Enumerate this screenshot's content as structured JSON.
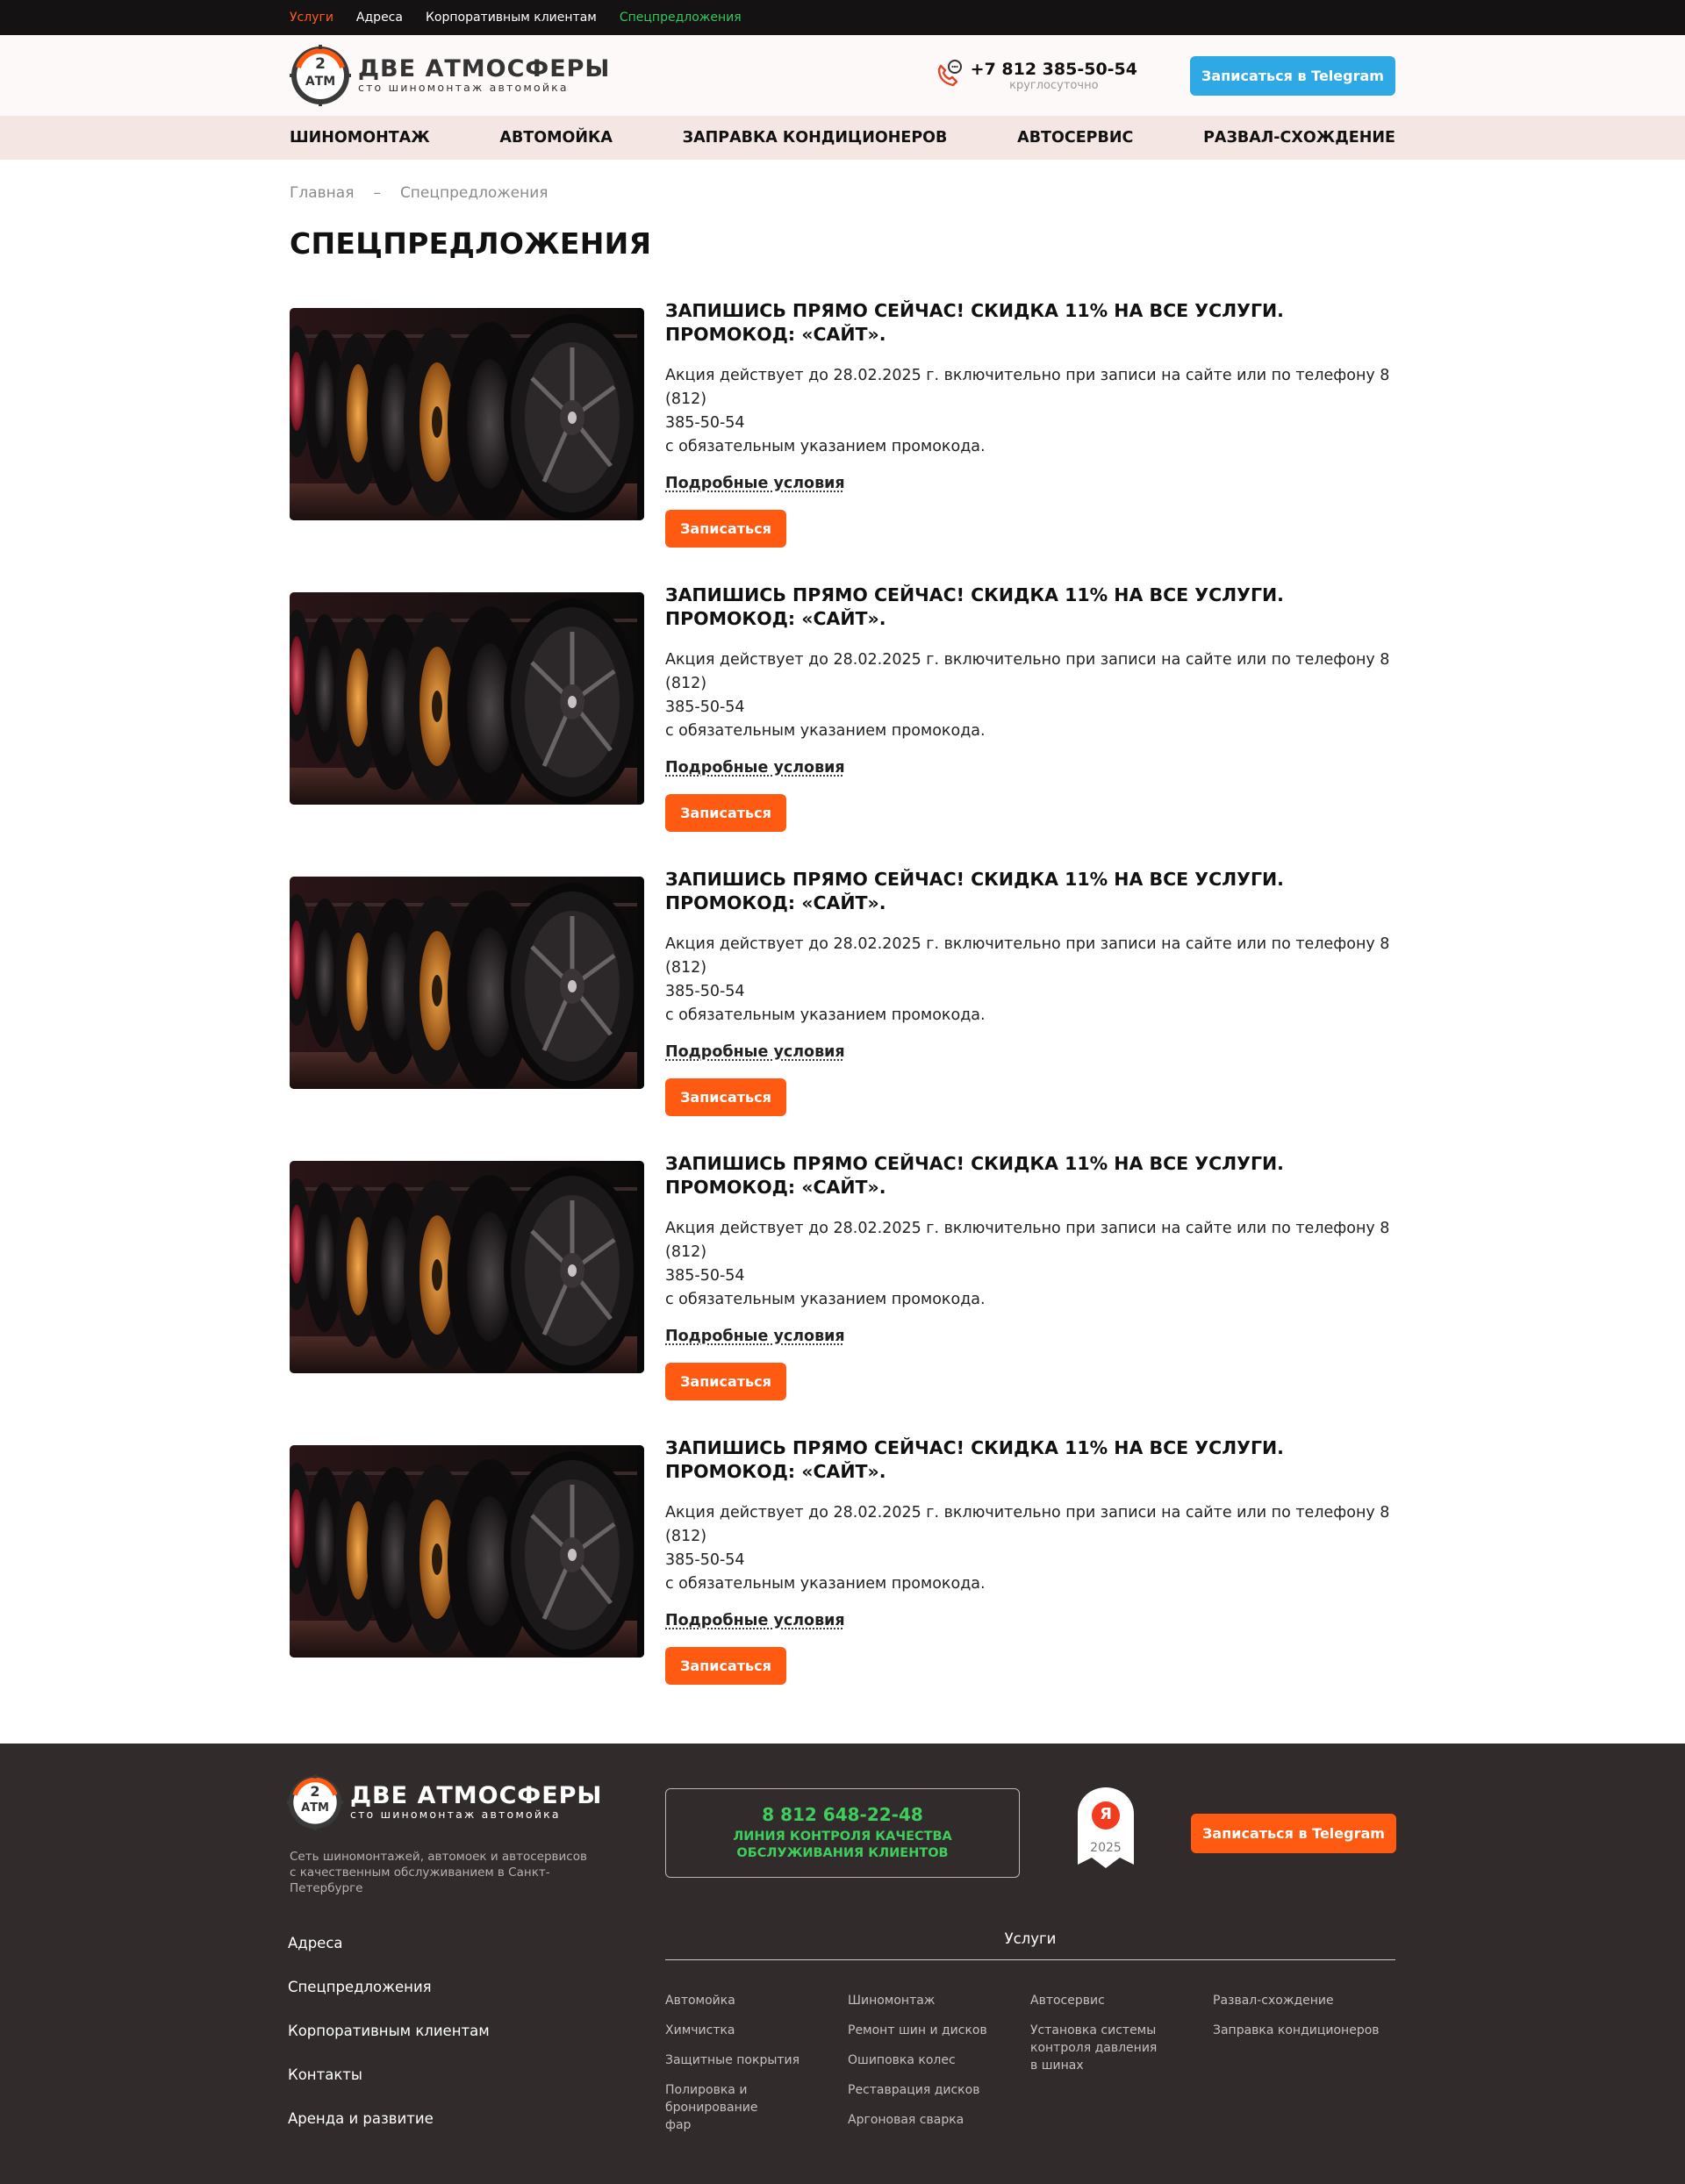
{
  "topbar": {
    "items": [
      "Услуги",
      "Адреса",
      "Корпоративным клиентам",
      "Спецпредложения"
    ]
  },
  "header": {
    "logo_badge_top": "2",
    "logo_badge_bottom": "АТМ",
    "logo_title": "ДВЕ АТМОСФЕРЫ",
    "logo_subtitle": "сто шиномонтаж автомойка",
    "phone": "+7 812 385-50-54",
    "phone_note": "круглосуточно",
    "telegram_button": "Записаться в Telegram"
  },
  "nav": {
    "items": [
      "ШИНОМОНТАЖ",
      "АВТОМОЙКА",
      "ЗАПРАВКА КОНДИЦИОНЕРОВ",
      "АВТОСЕРВИС",
      "РАЗВАЛ-СХОЖДЕНИЕ"
    ]
  },
  "breadcrumb": {
    "home": "Главная",
    "separator": "–",
    "current": "Спецпредложения"
  },
  "page": {
    "title": "СПЕЦПРЕДЛОЖЕНИЯ"
  },
  "offers": [
    {
      "title_line1": "ЗАПИШИСЬ ПРЯМО СЕЙЧАС! СКИДКА 11% НА ВСЕ УСЛУГИ.",
      "title_line2": "ПРОМОКОД: «САЙТ».",
      "desc_line1": "Акция действует до 28.02.2025 г. включительно при записи на сайте или по телефону 8 (812)",
      "desc_line2": "385-50-54",
      "desc_line3": "с обязательным указанием промокода.",
      "link": "Подробные условия",
      "button": "Записаться"
    },
    {
      "title_line1": "ЗАПИШИСЬ ПРЯМО СЕЙЧАС! СКИДКА 11% НА ВСЕ УСЛУГИ.",
      "title_line2": "ПРОМОКОД: «САЙТ».",
      "desc_line1": "Акция действует до 28.02.2025 г. включительно при записи на сайте или по телефону 8 (812)",
      "desc_line2": "385-50-54",
      "desc_line3": "с обязательным указанием промокода.",
      "link": "Подробные условия",
      "button": "Записаться"
    },
    {
      "title_line1": "ЗАПИШИСЬ ПРЯМО СЕЙЧАС! СКИДКА 11% НА ВСЕ УСЛУГИ.",
      "title_line2": "ПРОМОКОД: «САЙТ».",
      "desc_line1": "Акция действует до 28.02.2025 г. включительно при записи на сайте или по телефону 8 (812)",
      "desc_line2": "385-50-54",
      "desc_line3": "с обязательным указанием промокода.",
      "link": "Подробные условия",
      "button": "Записаться"
    },
    {
      "title_line1": "ЗАПИШИСЬ ПРЯМО СЕЙЧАС! СКИДКА 11% НА ВСЕ УСЛУГИ.",
      "title_line2": "ПРОМОКОД: «САЙТ».",
      "desc_line1": "Акция действует до 28.02.2025 г. включительно при записи на сайте или по телефону 8 (812)",
      "desc_line2": "385-50-54",
      "desc_line3": "с обязательным указанием промокода.",
      "link": "Подробные условия",
      "button": "Записаться"
    },
    {
      "title_line1": "ЗАПИШИСЬ ПРЯМО СЕЙЧАС! СКИДКА 11% НА ВСЕ УСЛУГИ.",
      "title_line2": "ПРОМОКОД: «САЙТ».",
      "desc_line1": "Акция действует до 28.02.2025 г. включительно при записи на сайте или по телефону 8 (812)",
      "desc_line2": "385-50-54",
      "desc_line3": "с обязательным указанием промокода.",
      "link": "Подробные условия",
      "button": "Записаться"
    }
  ],
  "footer": {
    "logo_title": "ДВЕ АТМОСФЕРЫ",
    "logo_subtitle": "сто шиномонтаж автомойка",
    "desc_line1": "Сеть шиномонтажей, автомоек и автосервисов",
    "desc_line2": "с качественным обслуживанием в Санкт-Петербурге",
    "quality_phone": "8 812 648-22-48",
    "quality_line1": "ЛИНИЯ КОНТРОЛЯ КАЧЕСТВА",
    "quality_line2": "ОБСЛУЖИВАНИЯ КЛИЕНТОВ",
    "award_letter": "Я",
    "award_year": "2025",
    "telegram_button": "Записаться в Telegram",
    "links": [
      "Адреса",
      "Спецпредложения",
      "Корпоративным клиентам",
      "Контакты",
      "Аренда и развитие"
    ],
    "services_title": "Услуги",
    "services_col1": [
      "Автомойка",
      "Химчистка",
      "Защитные покрытия",
      "Полировка и бронирование фар"
    ],
    "services_col2": [
      "Шиномонтаж",
      "Ремонт шин и дисков",
      "Ошиповка колес",
      "Реставрация дисков",
      "Аргоновая сварка"
    ],
    "services_col3": [
      "Автосервис",
      "Установка системы контроля давления в шинах"
    ],
    "services_col4": [
      "Развал-схождение",
      "Заправка кондиционеров"
    ]
  },
  "colors": {
    "accent_orange": "#ff5a12",
    "telegram_blue": "#2fa9e6",
    "quality_green": "#3fcd5d",
    "footer_bg": "#312b2b",
    "topbar_bg": "#141212",
    "nav_bg": "#f3e6e3"
  },
  "icons": {
    "phone": "phone-chat-icon",
    "logo": "tire-logo-icon",
    "award": "yandex-award-icon"
  }
}
